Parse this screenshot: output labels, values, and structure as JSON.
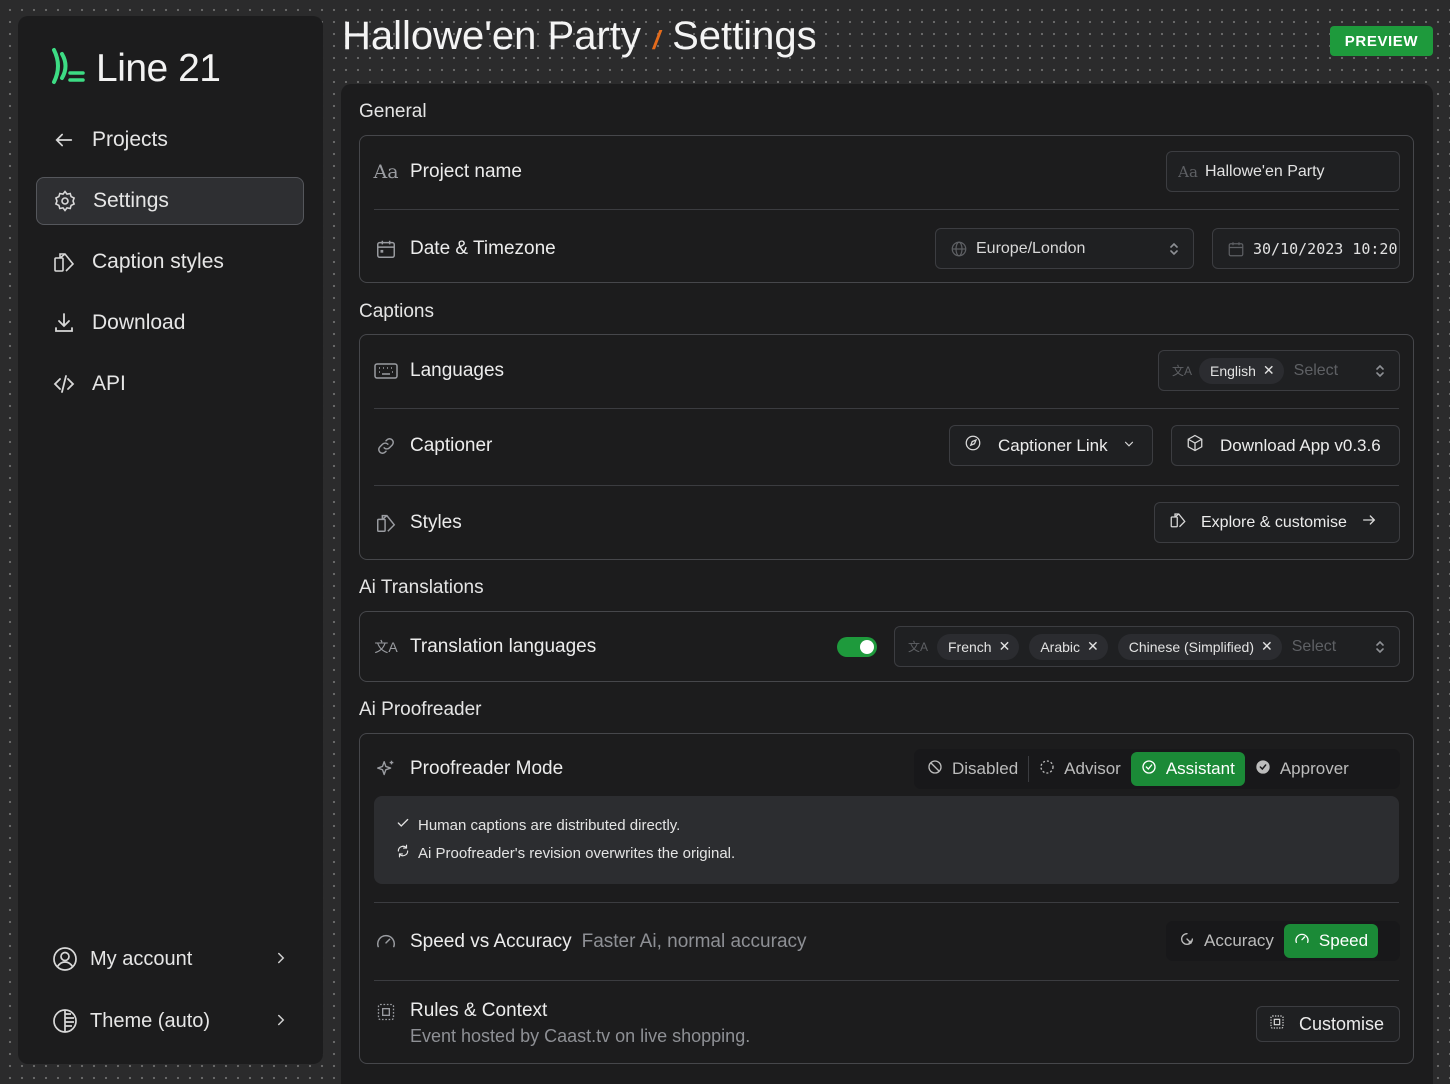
{
  "app": {
    "name": "Line 21"
  },
  "sidebar": {
    "items": [
      {
        "label": "Projects",
        "icon": "arrow-left-icon"
      },
      {
        "label": "Settings",
        "icon": "gear-icon",
        "active": true
      },
      {
        "label": "Caption styles",
        "icon": "styles-icon"
      },
      {
        "label": "Download",
        "icon": "download-icon"
      },
      {
        "label": "API",
        "icon": "code-icon"
      }
    ],
    "account": "My account",
    "theme": "Theme (auto)"
  },
  "header": {
    "project": "Hallowe'en Party",
    "separator": "/",
    "page": "Settings",
    "badge": "PREVIEW"
  },
  "general": {
    "title": "General",
    "project_name": {
      "label": "Project name",
      "value": "Hallowe'en Party"
    },
    "date_timezone": {
      "label": "Date & Timezone",
      "timezone": "Europe/London",
      "datetime": "30/10/2023 10:20"
    }
  },
  "captions": {
    "title": "Captions",
    "languages": {
      "label": "Languages",
      "chips": [
        "English"
      ],
      "placeholder": "Select"
    },
    "captioner": {
      "label": "Captioner",
      "link_button": "Captioner Link",
      "download_button": "Download App v0.3.6"
    },
    "styles": {
      "label": "Styles",
      "button": "Explore & customise"
    }
  },
  "ai_translations": {
    "title": "Ai Translations",
    "label": "Translation languages",
    "enabled": true,
    "chips": [
      "French",
      "Arabic",
      "Chinese (Simplified)"
    ],
    "placeholder": "Select"
  },
  "ai_proofreader": {
    "title": "Ai Proofreader",
    "mode": {
      "label": "Proofreader Mode",
      "options": [
        "Disabled",
        "Advisor",
        "Assistant",
        "Approver"
      ],
      "selected": "Assistant",
      "notes": [
        "Human captions are distributed directly.",
        "Ai Proofreader's revision overwrites the original."
      ]
    },
    "speed": {
      "label": "Speed vs Accuracy",
      "description": "Faster Ai, normal accuracy",
      "options": [
        "Accuracy",
        "Speed"
      ],
      "selected": "Speed"
    },
    "rules": {
      "label": "Rules & Context",
      "description": "Event hosted by Caast.tv on live shopping.",
      "button": "Customise"
    }
  },
  "colors": {
    "accent": "#1e9a3c",
    "background": "#1c1c1d",
    "separator": "#e36b1c",
    "logo": "#3ddc84"
  }
}
